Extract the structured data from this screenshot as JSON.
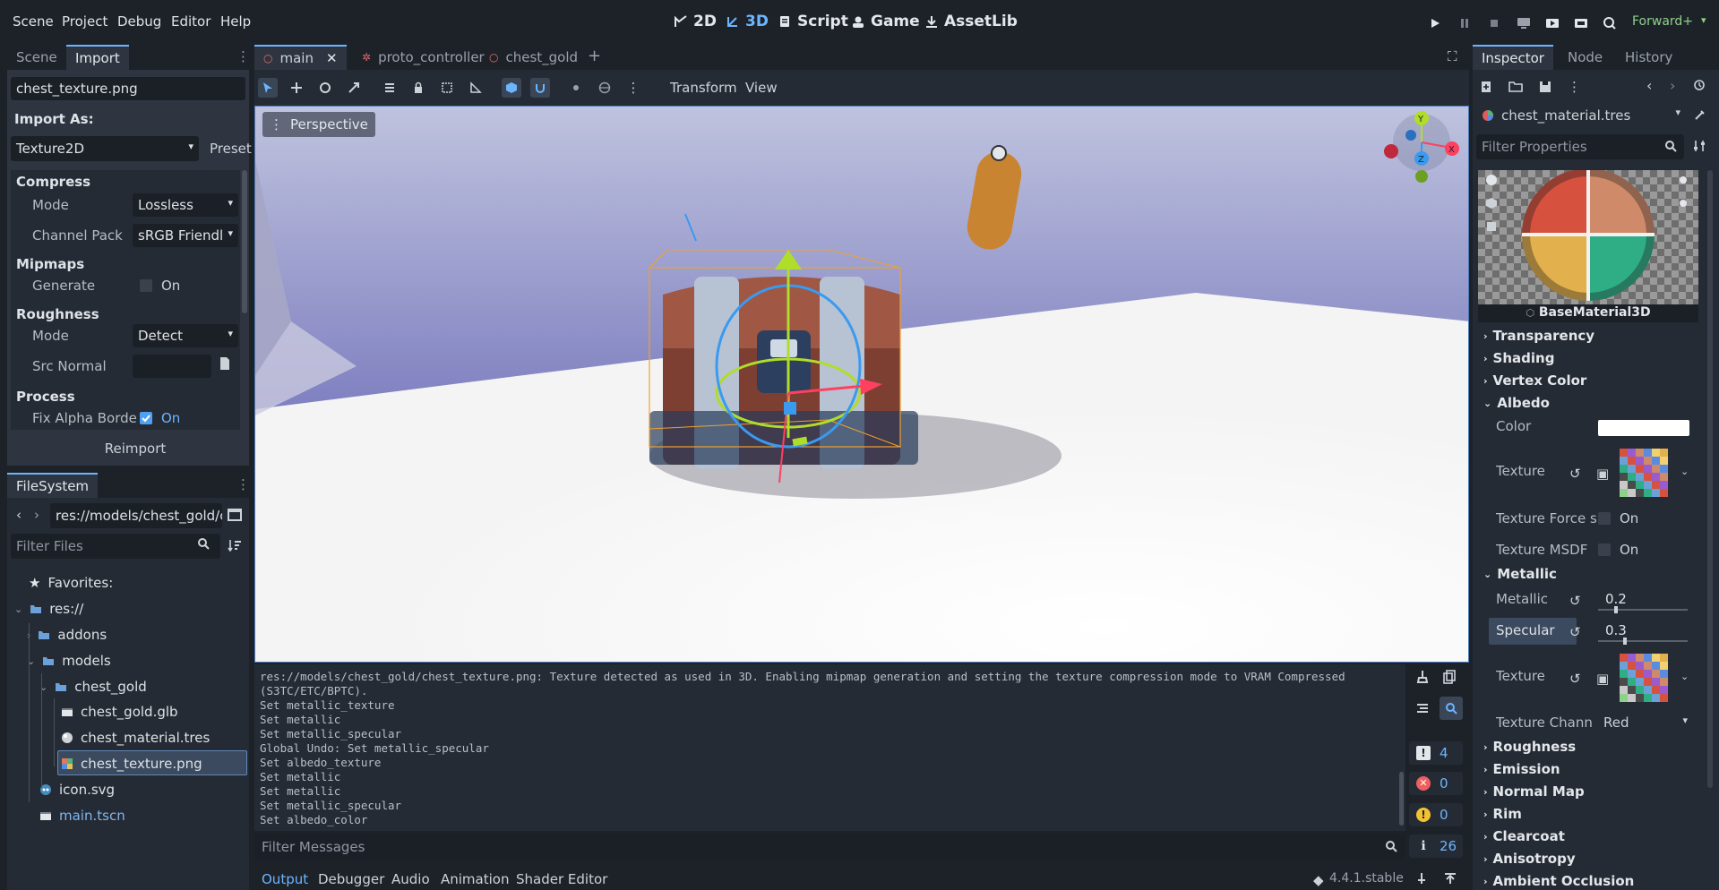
{
  "menu": [
    "Scene",
    "Project",
    "Debug",
    "Editor",
    "Help"
  ],
  "workspaces": [
    {
      "label": "2D"
    },
    {
      "label": "3D"
    },
    {
      "label": "Script"
    },
    {
      "label": "Game"
    },
    {
      "label": "AssetLib"
    }
  ],
  "renderer": "Forward+",
  "left_top": {
    "tabs": [
      "Scene",
      "Import"
    ],
    "file_name": "chest_texture.png",
    "import_as_label": "Import As:",
    "import_as_value": "Texture2D",
    "preset_label": "Preset",
    "sections": {
      "compress": "Compress",
      "mode_label": "Mode",
      "mode_value": "Lossless",
      "channel_pack_label": "Channel Pack",
      "channel_pack_value": "sRGB Friendl",
      "mipmaps": "Mipmaps",
      "generate_label": "Generate",
      "generate_value": "On",
      "roughness": "Roughness",
      "rough_mode_label": "Mode",
      "rough_mode_value": "Detect",
      "src_normal_label": "Src Normal",
      "process": "Process",
      "fix_alpha_label": "Fix Alpha Borde",
      "fix_alpha_value": "On"
    },
    "reimport_label": "Reimport"
  },
  "filesystem": {
    "title": "FileSystem",
    "path": "res://models/chest_gold/c",
    "filter_placeholder": "Filter Files",
    "favorites": "Favorites:",
    "items": [
      {
        "label": "res://"
      },
      {
        "label": "addons"
      },
      {
        "label": "models"
      },
      {
        "label": "chest_gold"
      },
      {
        "label": "chest_gold.glb"
      },
      {
        "label": "chest_material.tres"
      },
      {
        "label": "chest_texture.png"
      },
      {
        "label": "icon.svg"
      },
      {
        "label": "main.tscn"
      }
    ]
  },
  "editor_tabs": [
    "main",
    "proto_controller",
    "chest_gold"
  ],
  "viewport": {
    "transform_label": "Transform",
    "view_label": "View",
    "perspective_label": "Perspective",
    "gizmo": {
      "y": "Y",
      "x": "X",
      "z": "Z"
    }
  },
  "output": {
    "lines": [
      "res://models/chest_gold/chest_texture.png: Texture detected as used in 3D. Enabling mipmap generation and setting the texture compression mode to VRAM Compressed",
      "(S3TC/ETC/BPTC).",
      "Set metallic_texture",
      "Set metallic",
      "Set metallic_specular",
      "Global Undo: Set metallic_specular",
      "Set albedo_texture",
      "Set metallic",
      "Set metallic",
      "Set metallic_specular",
      "Set albedo_color"
    ],
    "filter_placeholder": "Filter Messages",
    "counts": {
      "messages": "4",
      "errors": "0",
      "warnings": "0",
      "logs": "26"
    }
  },
  "bottom_tabs": [
    "Output",
    "Debugger",
    "Audio",
    "Animation",
    "Shader Editor"
  ],
  "version": "4.4.1.stable",
  "inspector": {
    "tabs": [
      "Inspector",
      "Node",
      "History"
    ],
    "resource": "chest_material.tres",
    "filter_placeholder": "Filter Properties",
    "preview_title": "BaseMaterial3D",
    "sections_collapsed_top": [
      "Transparency",
      "Shading",
      "Vertex Color"
    ],
    "albedo": "Albedo",
    "color_label": "Color",
    "texture_label": "Texture",
    "texture_force_label": "Texture Force s",
    "texture_force_value": "On",
    "texture_msdf_label": "Texture MSDF",
    "texture_msdf_value": "On",
    "metallic_section": "Metallic",
    "metallic_label": "Metallic",
    "metallic_value": "0.2",
    "metallic_fraction": 0.2,
    "specular_label": "Specular",
    "specular_value": "0.3",
    "specular_fraction": 0.3,
    "metal_texture_label": "Texture",
    "texture_channel_label": "Texture Chann",
    "texture_channel_value": "Red",
    "sections_collapsed_bottom": [
      "Roughness",
      "Emission",
      "Normal Map",
      "Rim",
      "Clearcoat",
      "Anisotropy",
      "Ambient Occlusion"
    ]
  },
  "colors": {
    "accent": "#6cb5ff",
    "bg": "#1d2229",
    "panel": "#252b34"
  }
}
